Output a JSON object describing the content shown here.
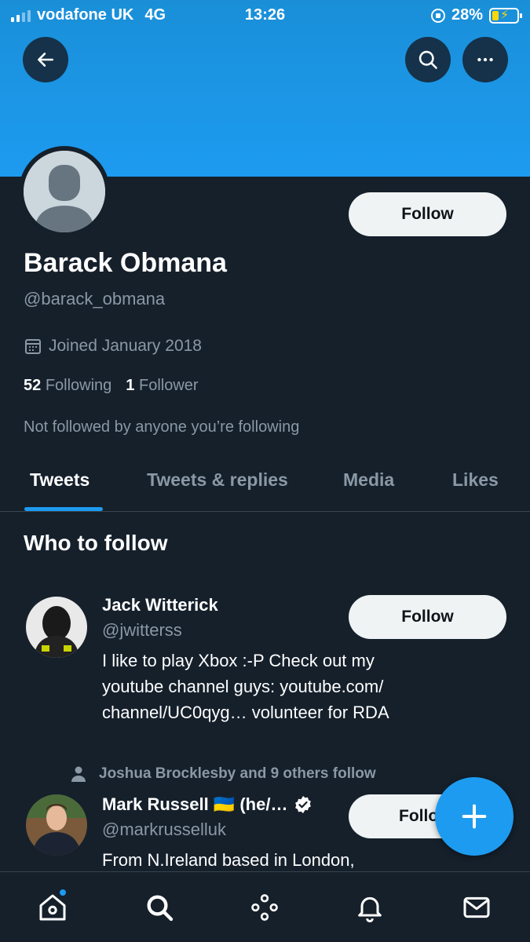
{
  "status_bar": {
    "carrier": "vodafone UK",
    "network": "4G",
    "time": "13:26",
    "battery": "28%"
  },
  "header": {
    "back_icon": "arrow-left-icon",
    "search_icon": "search-icon",
    "more_icon": "more-horizontal-icon"
  },
  "profile": {
    "follow_label": "Follow",
    "name": "Barack Obmana",
    "handle": "@barack_obmana",
    "joined": "Joined January 2018",
    "following_count": "52",
    "following_label": "Following",
    "followers_count": "1",
    "followers_label": "Follower",
    "not_followed": "Not followed by anyone you’re following"
  },
  "tabs": [
    {
      "label": "Tweets",
      "active": true
    },
    {
      "label": "Tweets & replies"
    },
    {
      "label": "Media"
    },
    {
      "label": "Likes"
    }
  ],
  "who_to_follow": {
    "title": "Who to follow",
    "suggestions": [
      {
        "name": "Jack Witterick",
        "handle": "@jwitterss",
        "follow_label": "Follow",
        "bio_lines": [
          "I like to play Xbox :-P Check out my",
          "youtube channel guys: youtube.com/",
          "channel/UC0qyg… volunteer for RDA"
        ]
      },
      {
        "social_context": "Joshua Brocklesby and 9 others follow",
        "name": "Mark Russell 🇺🇦 (he/…",
        "handle": "@markrusselluk",
        "follow_label": "Follo",
        "verified": true,
        "bio_lines": [
          "From N.Ireland based in London,"
        ]
      }
    ]
  },
  "bottom_nav": [
    "home-icon",
    "search-icon",
    "spaces-icon",
    "notifications-icon",
    "messages-icon"
  ],
  "colors": {
    "background": "#15202b",
    "accent": "#1d9bf0",
    "secondary_text": "#8b98a5"
  }
}
